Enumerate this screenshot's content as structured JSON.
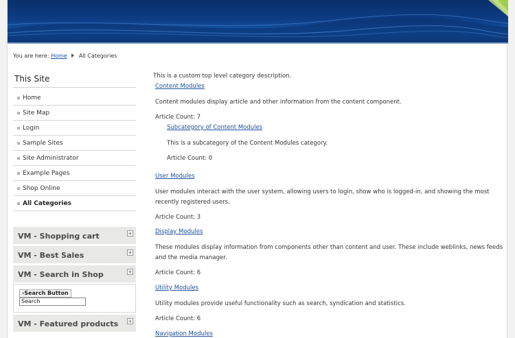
{
  "breadcrumb": {
    "prefix": "You are here:",
    "home": "Home",
    "current": "All Categories"
  },
  "sidebar": {
    "title": "This Site",
    "items": [
      {
        "label": "Home"
      },
      {
        "label": "Site Map"
      },
      {
        "label": "Login"
      },
      {
        "label": "Sample Sites"
      },
      {
        "label": "Site Administrator"
      },
      {
        "label": "Example Pages"
      },
      {
        "label": "Shop Online"
      },
      {
        "label": "All Categories"
      }
    ],
    "modules": [
      {
        "title": "VM - Shopping cart",
        "toggle": "+"
      },
      {
        "title": "VM - Best Sales",
        "toggle": "+"
      },
      {
        "title": "VM - Search in Shop",
        "toggle": "+"
      },
      {
        "title": "VM - Featured products",
        "toggle": "+"
      }
    ],
    "search": {
      "button_label": "›Search Button",
      "input_value": "Search"
    }
  },
  "content": {
    "intro": "This is a custom top level category description.",
    "categories": [
      {
        "title": "Content Modules",
        "description": "Content modules display article and other information from the content component.",
        "count": "Article Count: 7",
        "subcategory": {
          "title": "Subcategory of Content Modules",
          "description": "This is a subcategory of the Content Modules category.",
          "count": "Article Count: 0"
        }
      },
      {
        "title": "User Modules",
        "description": "User modules interact with the user system, allowing users to login, show who is logged-in, and showing the most recently registered users.",
        "count": "Article Count: 3"
      },
      {
        "title": "Display Modules",
        "description": "These modules display information from components other than content and user. These include weblinks, news feeds and the media manager.",
        "count": "Article Count: 6"
      },
      {
        "title": "Utility Modules",
        "description": "Utility modules provide useful functionality such as search, syndication and statistics.",
        "count": "Article Count: 6"
      },
      {
        "title": "Navigation Modules"
      }
    ]
  }
}
